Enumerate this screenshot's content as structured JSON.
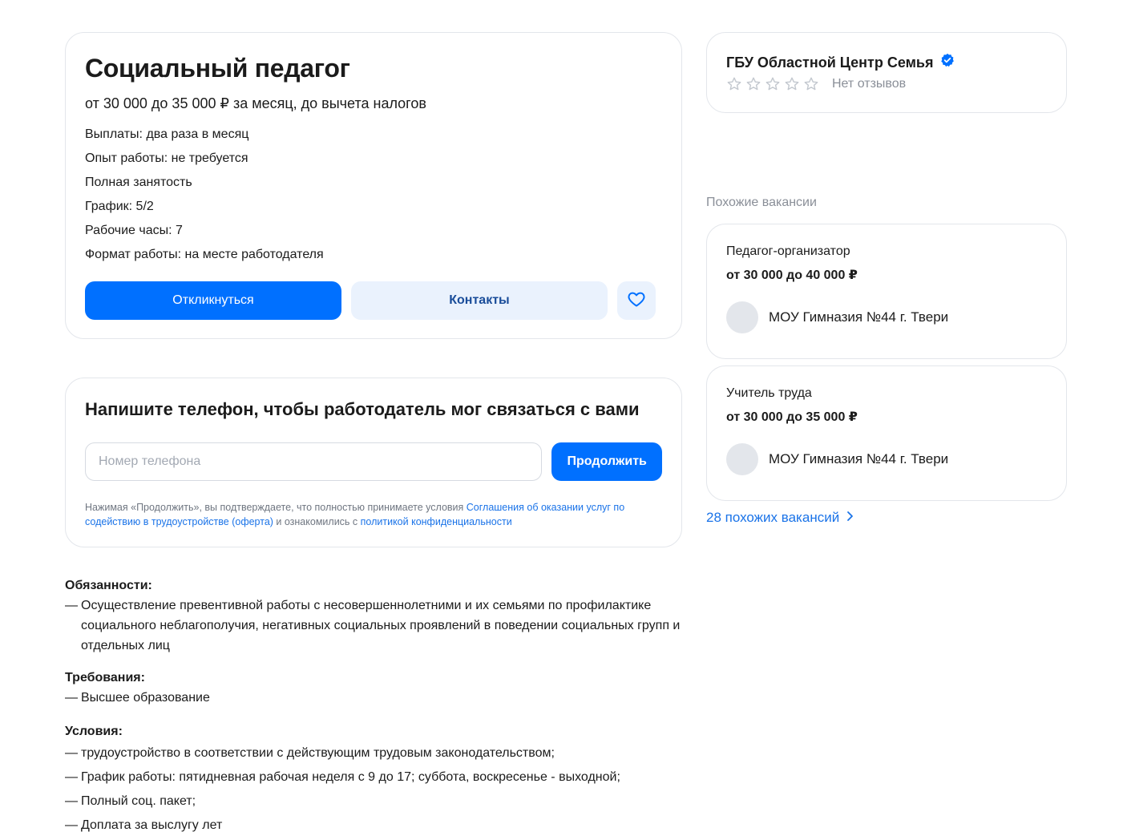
{
  "vacancy": {
    "title": "Социальный педагог",
    "salary": "от 30 000 до 35 000 ₽ за месяц, до вычета налогов",
    "properties": [
      "Выплаты: два раза в месяц",
      "Опыт работы: не требуется",
      "Полная занятость",
      "График: 5/2",
      "Рабочие часы: 7",
      "Формат работы: на месте работодателя"
    ],
    "respond_label": "Откликнуться",
    "contacts_label": "Контакты",
    "favorite_icon": "heart-icon"
  },
  "phone_form": {
    "title": "Напишите телефон, чтобы работодатель мог связаться с вами",
    "placeholder": "Номер телефона",
    "value": "",
    "submit_label": "Продолжить",
    "legal_prefix": "Нажимая «Продолжить», вы подтверждаете, что полностью принимаете условия ",
    "legal_link1": "Соглашения об оказании услуг по содействию в трудоустройстве (оферта)",
    "legal_middle": " и ознакомились с ",
    "legal_link2": "политикой конфиденциальности"
  },
  "description": {
    "duties_title": "Обязанности:",
    "duties": [
      "Осуществление превентивной работы с несовершеннолетними и их семьями по профилактике социального неблагополучия, негативных социальных проявлений в поведении социальных групп и отдельных лиц"
    ],
    "requirements_title": "Требования:",
    "requirements": [
      "Высшее образование"
    ],
    "conditions_title": "Условия:",
    "conditions": [
      "трудоустройство в соответствии с действующим трудовым законодательством;",
      "График работы: пятидневная рабочая неделя с 9 до 17; суббота, воскресенье - выходной;",
      "Полный соц. пакет;",
      "Доплата за выслугу лет"
    ]
  },
  "employer": {
    "name": "ГБУ Областной Центр Семья",
    "verified_icon": "verified-badge-icon",
    "rating_stars": 0,
    "rating_max": 5,
    "reviews_label": "Нет отзывов"
  },
  "similar": {
    "heading": "Похожие вакансии",
    "items": [
      {
        "title": "Педагог-организатор",
        "salary": "от 30 000 до 40 000 ₽",
        "company": "МОУ Гимназия №44 г. Твери"
      },
      {
        "title": "Учитель труда",
        "salary": "от 30 000 до 35 000 ₽",
        "company": "МОУ Гимназия №44 г. Твери"
      }
    ],
    "more_label": "28 похожих вакансий"
  },
  "colors": {
    "accent": "#0070ff",
    "secondary_bg": "#eaf2fd",
    "link": "#1a73e8",
    "muted": "#8a8f98"
  }
}
